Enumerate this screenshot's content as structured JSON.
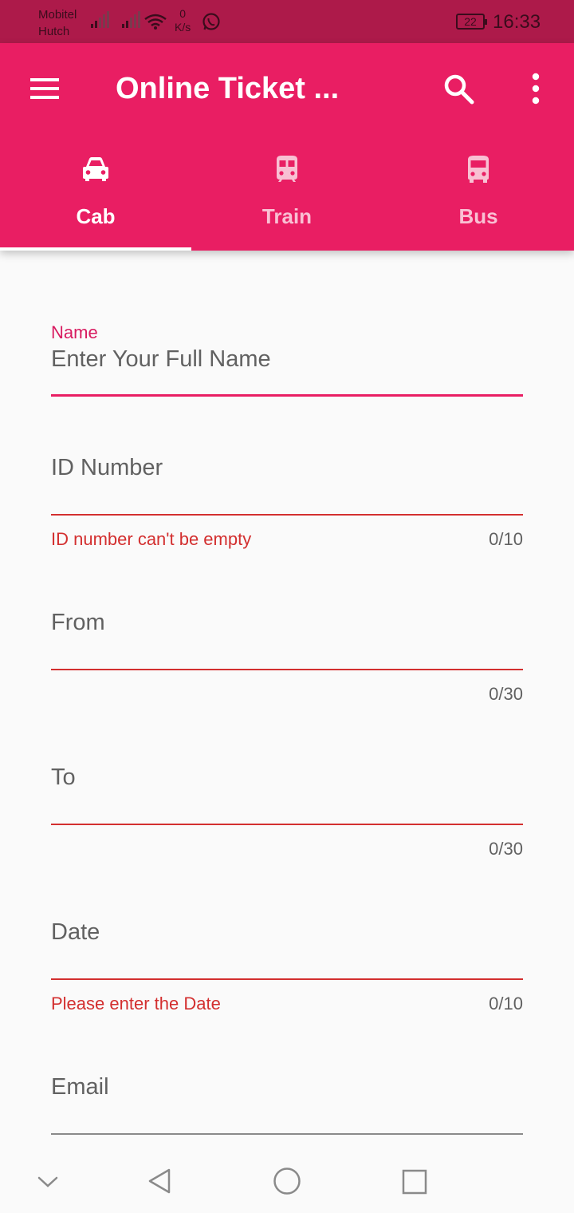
{
  "status_bar": {
    "carrier_1": "Mobitel",
    "carrier_2": "Hutch",
    "speed_value": "0",
    "speed_unit": "K/s",
    "battery": "22",
    "time": "16:33"
  },
  "app_bar": {
    "title": "Online Ticket ...",
    "icons": {
      "menu": "menu-icon",
      "search": "search-icon",
      "more": "more-vert-icon"
    }
  },
  "tabs": [
    {
      "label": "Cab",
      "icon": "car-icon",
      "active": true
    },
    {
      "label": "Train",
      "icon": "train-icon",
      "active": false
    },
    {
      "label": "Bus",
      "icon": "bus-icon",
      "active": false
    }
  ],
  "form": {
    "name": {
      "label": "Name",
      "value": "Enter Your Full Name"
    },
    "id_number": {
      "placeholder": "ID Number",
      "error": "ID number can't be empty",
      "counter": "0/10"
    },
    "from": {
      "placeholder": "From",
      "counter": "0/30"
    },
    "to": {
      "placeholder": "To",
      "counter": "0/30"
    },
    "date": {
      "placeholder": "Date",
      "error": "Please enter the Date",
      "counter": "0/10"
    },
    "email": {
      "placeholder": "Email"
    }
  },
  "colors": {
    "primary": "#e91e63",
    "status_bar": "#ad1a4a",
    "error": "#d32f2f",
    "focused_label": "#d81b60"
  }
}
